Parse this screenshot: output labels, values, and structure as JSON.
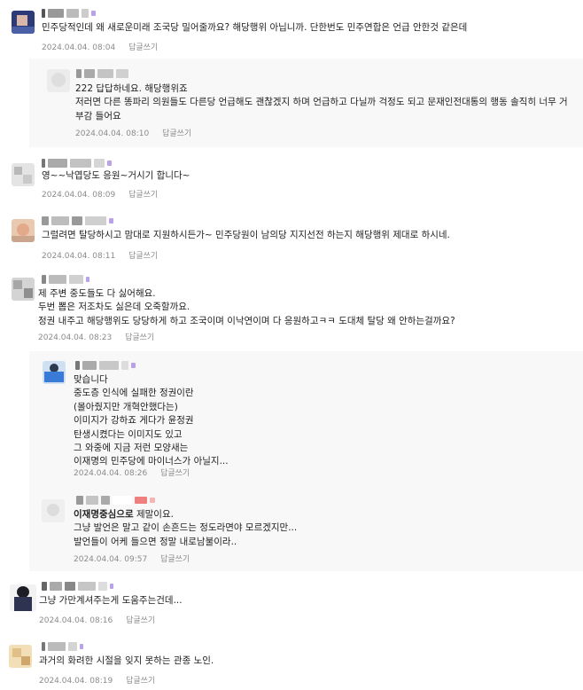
{
  "reply_label": "답글쓰기",
  "comments": [
    {
      "text": "민주당적인데 왜 새로운미래 조국당 밀어줄까요? 해당행위 아닙니까. 단한번도 민주연합은 언급 안한것 같은데",
      "date": "2024.04.04.",
      "time": "08:04"
    },
    {
      "text": "222 답답하네요. 해당행위죠\n저러면 다른 똥파리 의원들도 다른당 언급해도 괜찮겠지 하며 언급하고 다닐까 걱정도 되고 문재인전대통의 행동 솔직히 너무 거부감 들어요",
      "date": "2024.04.04.",
      "time": "08:10"
    },
    {
      "text": "영~~낙엽당도 응원~거시기 합니다~",
      "date": "2024.04.04.",
      "time": "08:09"
    },
    {
      "text": "그럴려면 탈당하시고 맘대로 지원하시든가~ 민주당원이 남의당 지지선전 하는지 해당행위 제대로 하시네.",
      "date": "2024.04.04.",
      "time": "08:11"
    },
    {
      "text": "제 주변 중도들도 다 싫어해요.\n두번 뽑은 저조차도 싫은데 오죽할까요.\n정권 내주고 해당행위도 당당하게 하고 조국이며 이낙연이며 다 응원하고ㅋㅋ 도대체 탈당 왜 안하는걸까요?",
      "date": "2024.04.04.",
      "time": "08:23"
    },
    {
      "text": "맞습니다\n중도층 인식에 실패한 정권이란\n(몰아줬지만 개혁안했다는)\n이미지가 강하죠 게다가 윤정권\n탄생시켰다는 이미지도 있고\n그 와중에 지금 저런 모양새는\n이재명의 민주당에 마이너스가 아닐지...",
      "date": "2024.04.04.",
      "time": "08:26"
    },
    {
      "mention": "이재명중심으로",
      "text": " 제말이요.\n그냥 발언은 말고 같이 손흔드는 정도라면야 모르겠지만...\n발언들이 어케 들으면 정말 내로남불이라..",
      "date": "2024.04.04.",
      "time": "09:57"
    },
    {
      "text": "그냥 가만계셔주는게 도움주는건데...",
      "date": "2024.04.04.",
      "time": "08:16"
    },
    {
      "text": "과거의 화려한 시절을 잊지 못하는 관종 노인.",
      "date": "2024.04.04.",
      "time": "08:19"
    }
  ],
  "colors": {
    "text": "#222222",
    "meta": "#8b8b8b",
    "reply_bg": "#f8f8f8",
    "badge_purple": "#b9a2ea",
    "badge_red": "#f08080"
  }
}
